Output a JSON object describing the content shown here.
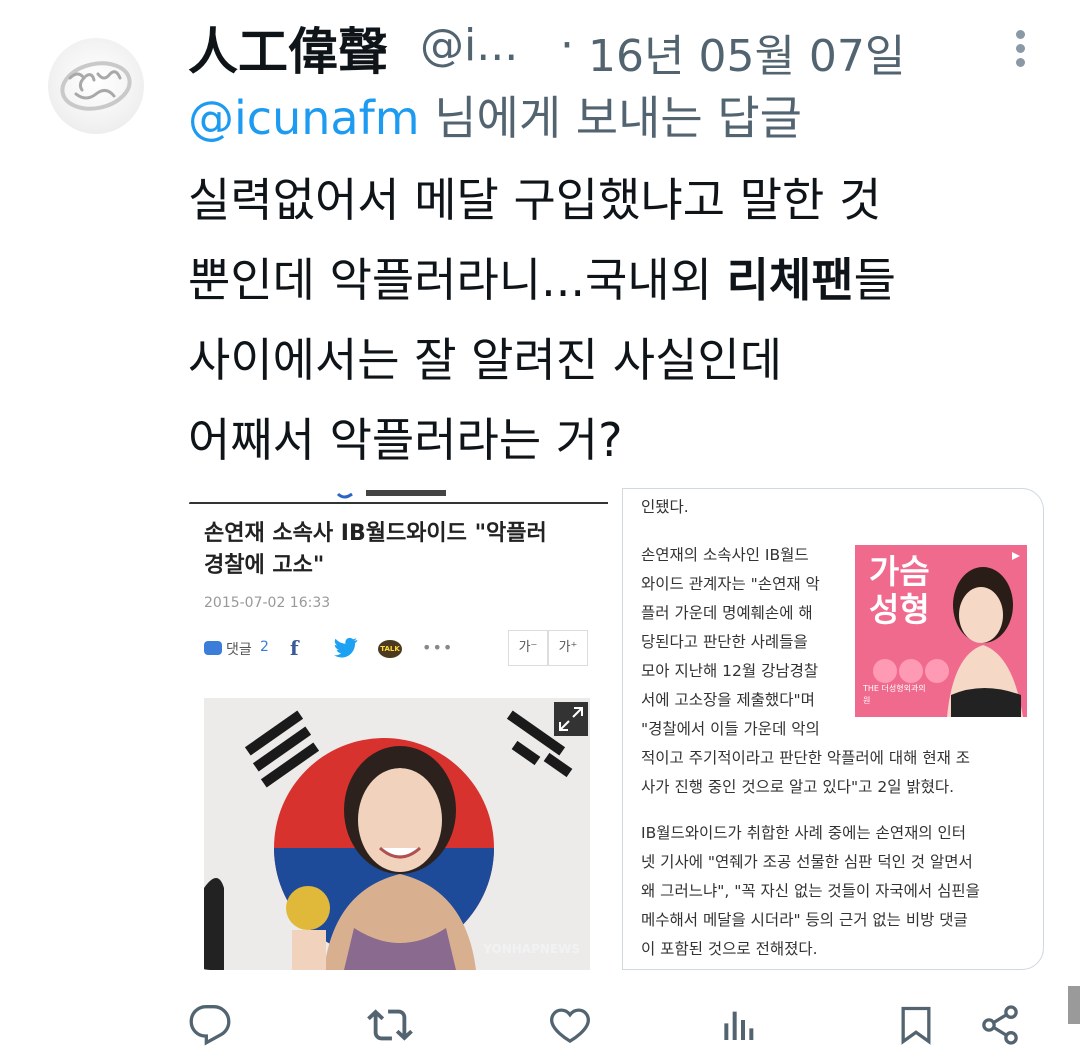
{
  "tweet": {
    "display_name": "人工偉聲",
    "handle": "@i...",
    "separator": "·",
    "date": "16년 05월 07일",
    "reply_to_handle": "@icunafm",
    "reply_to_suffix": " 님에게 보내는 답글",
    "text_lines": [
      "실력없어서 메달 구입했냐고 말한 것",
      "뿐인데 악플러라니...국내외 ",
      "사이에서는 잘 알려진 사실인데",
      "어째서 악플러라는 거?"
    ],
    "text_bold": "리체팬",
    "text_after_bold": "들"
  },
  "article_left": {
    "title_lines": [
      "손연재 소속사 IB월드와이드 \"악플러",
      "경찰에 고소\""
    ],
    "date": "2015-07-02 16:33",
    "comment_label": "댓글",
    "comment_count": "2",
    "facebook_glyph": "f",
    "kakao_label": "TALK",
    "more_glyph": "•••",
    "font_smaller": "가⁻",
    "font_larger": "가⁺",
    "watermark": "YONHAPNEWS"
  },
  "article_right": {
    "line0": "인됐다.",
    "para1_lines": [
      "손연재의 소속사인 IB월드",
      "와이드 관계자는 \"손연재 악",
      "플러 가운데 명예훼손에 해",
      "당된다고 판단한 사례들을",
      "모아 지난해 12월 강남경찰",
      "서에 고소장을 제출했다\"며",
      "\"경찰에서 이들 가운데 악의"
    ],
    "para1_full_lines": [
      "적이고 주기적이라고 판단한 악플러에 대해 현재 조",
      "사가 진행 중인 것으로 알고 있다\"고 2일 밝혔다."
    ],
    "para2_lines": [
      "IB월드와이드가 취합한 사례 중에는 손연재의 인터",
      "넷 기사에 \"연줴가 조공 선물한 심판 덕인 것 알면서",
      "왜 그러느냐\", \"꼭 자신 없는 것들이 자국에서 심핀을",
      "메수해서 메달을 시더라\" 등의 근거 없는 비방 댓글",
      "이 포함된 것으로 전해졌다."
    ],
    "ad": {
      "title_lines": [
        "가슴",
        "성형"
      ],
      "badge": "THE 더성형외과의원"
    }
  },
  "actions": {
    "icons": [
      "reply-icon",
      "retweet-icon",
      "like-icon",
      "analytics-icon",
      "bookmark-icon",
      "share-icon"
    ]
  },
  "colors": {
    "accent": "#1d9bf0",
    "secondary_text": "#536471",
    "primary_text": "#0f1419"
  }
}
